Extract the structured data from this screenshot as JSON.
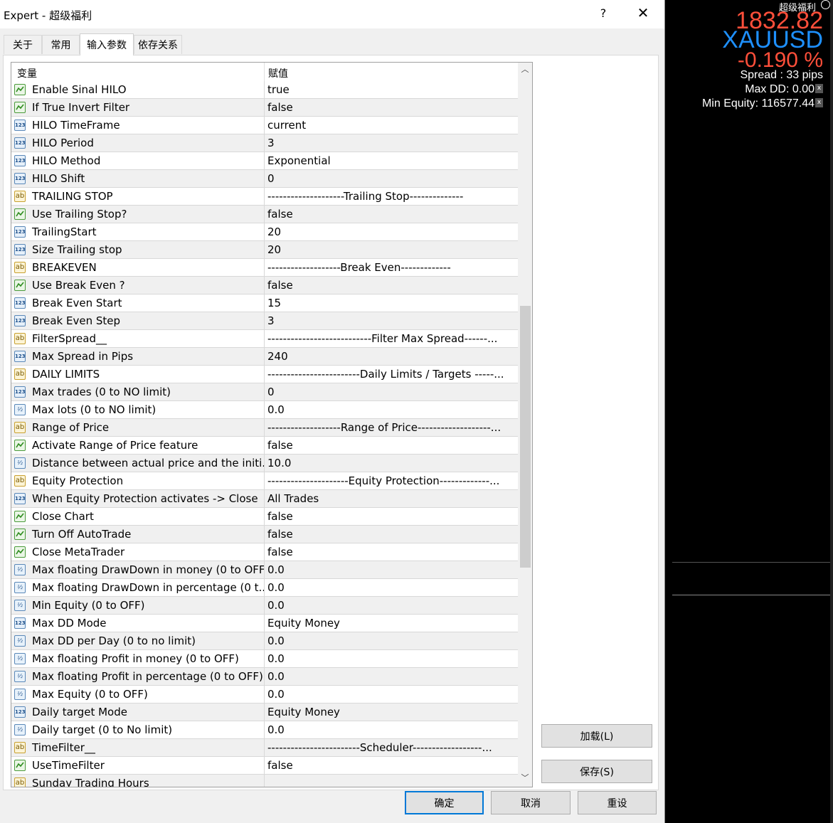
{
  "window": {
    "title": "Expert - 超级福利",
    "help_label": "?",
    "close_label": "✕"
  },
  "tabs": [
    {
      "label": "关于"
    },
    {
      "label": "常用"
    },
    {
      "label": "输入参数"
    },
    {
      "label": "依存关系"
    }
  ],
  "grid": {
    "header_variable": "变量",
    "header_value": "赋值",
    "scroll_up": "︿",
    "scroll_down": "﹀",
    "rows": [
      {
        "type": "bool",
        "name": "Enable Sinal  HILO",
        "value": "true"
      },
      {
        "type": "bool",
        "name": "If True Invert Filter",
        "value": "false"
      },
      {
        "type": "int",
        "name": "HILO TimeFrame",
        "value": "current"
      },
      {
        "type": "int",
        "name": "HILO Period",
        "value": "3"
      },
      {
        "type": "int",
        "name": "HILO Method",
        "value": "Exponential"
      },
      {
        "type": "int",
        "name": "HILO Shift",
        "value": "0"
      },
      {
        "type": "str",
        "name": "TRAILING STOP",
        "value": "--------------------Trailing Stop--------------"
      },
      {
        "type": "bool",
        "name": "Use Trailing Stop?",
        "value": "false"
      },
      {
        "type": "int",
        "name": "TrailingStart",
        "value": "20"
      },
      {
        "type": "int",
        "name": "Size Trailing stop",
        "value": "20"
      },
      {
        "type": "str",
        "name": "BREAKEVEN",
        "value": "-------------------Break Even-------------"
      },
      {
        "type": "bool",
        "name": "Use Break Even ?",
        "value": "false"
      },
      {
        "type": "int",
        "name": "Break Even Start",
        "value": "15"
      },
      {
        "type": "int",
        "name": "Break Even Step",
        "value": "3"
      },
      {
        "type": "str",
        "name": "FilterSpread__",
        "value": "---------------------------Filter Max Spread------..."
      },
      {
        "type": "int",
        "name": "Max Spread in Pips",
        "value": "240"
      },
      {
        "type": "str",
        "name": "DAILY LIMITS",
        "value": "------------------------Daily Limits / Targets -----..."
      },
      {
        "type": "int",
        "name": "Max trades (0 to NO limit)",
        "value": "0"
      },
      {
        "type": "dbl",
        "name": "Max lots (0 to NO limit)",
        "value": "0.0"
      },
      {
        "type": "str",
        "name": "Range of Price",
        "value": "-------------------Range of Price-------------------..."
      },
      {
        "type": "bool",
        "name": "Activate Range of Price feature",
        "value": "false"
      },
      {
        "type": "dbl",
        "name": "Distance between actual price and the initi...",
        "value": "10.0"
      },
      {
        "type": "str",
        "name": "Equity Protection",
        "value": "---------------------Equity Protection-------------..."
      },
      {
        "type": "int",
        "name": "When Equity Protection activates -> Close",
        "value": "All Trades"
      },
      {
        "type": "bool",
        "name": "Close Chart",
        "value": "false"
      },
      {
        "type": "bool",
        "name": "Turn Off AutoTrade",
        "value": "false"
      },
      {
        "type": "bool",
        "name": "Close MetaTrader",
        "value": "false"
      },
      {
        "type": "dbl",
        "name": "Max floating DrawDown in money (0 to OFF)",
        "value": "0.0"
      },
      {
        "type": "dbl",
        "name": "Max floating DrawDown in percentage (0 t...",
        "value": "0.0"
      },
      {
        "type": "dbl",
        "name": "Min Equity (0 to OFF)",
        "value": "0.0"
      },
      {
        "type": "int",
        "name": "Max DD Mode",
        "value": "Equity Money"
      },
      {
        "type": "dbl",
        "name": "Max DD per Day (0 to no limit)",
        "value": "0.0"
      },
      {
        "type": "dbl",
        "name": "Max floating Profit in money (0 to OFF)",
        "value": "0.0"
      },
      {
        "type": "dbl",
        "name": "Max floating Profit in percentage (0 to OFF)",
        "value": "0.0"
      },
      {
        "type": "dbl",
        "name": "Max Equity (0 to OFF)",
        "value": "0.0"
      },
      {
        "type": "int",
        "name": "Daily target Mode",
        "value": "Equity Money"
      },
      {
        "type": "dbl",
        "name": "Daily target (0 to No limit)",
        "value": "0.0"
      },
      {
        "type": "str",
        "name": "TimeFilter__",
        "value": "------------------------Scheduler------------------..."
      },
      {
        "type": "bool",
        "name": "UseTimeFilter",
        "value": "false"
      },
      {
        "type": "str",
        "name": "Sunday Trading Hours",
        "value": ""
      }
    ]
  },
  "buttons": {
    "load": "加载(L)",
    "save": "保存(S)",
    "ok": "确定",
    "cancel": "取消",
    "reset": "重设"
  },
  "chart_overlay": {
    "brand": "超级福利",
    "price": "1832.82",
    "symbol": "XAUUSD",
    "change": "-0.190 %",
    "spread": "Spread : 33 pips",
    "max_dd": "Max DD: 0.00",
    "min_equity": "Min Equity: 116577.44",
    "x_mark": "x"
  },
  "colors": {
    "price_red": "#ff4f3a",
    "symbol_blue": "#1e90ff",
    "primary_border": "#0078d7"
  },
  "icons": {
    "bool": "bool-param-icon",
    "int": "int-param-icon",
    "str": "string-param-icon",
    "dbl": "double-param-icon"
  }
}
